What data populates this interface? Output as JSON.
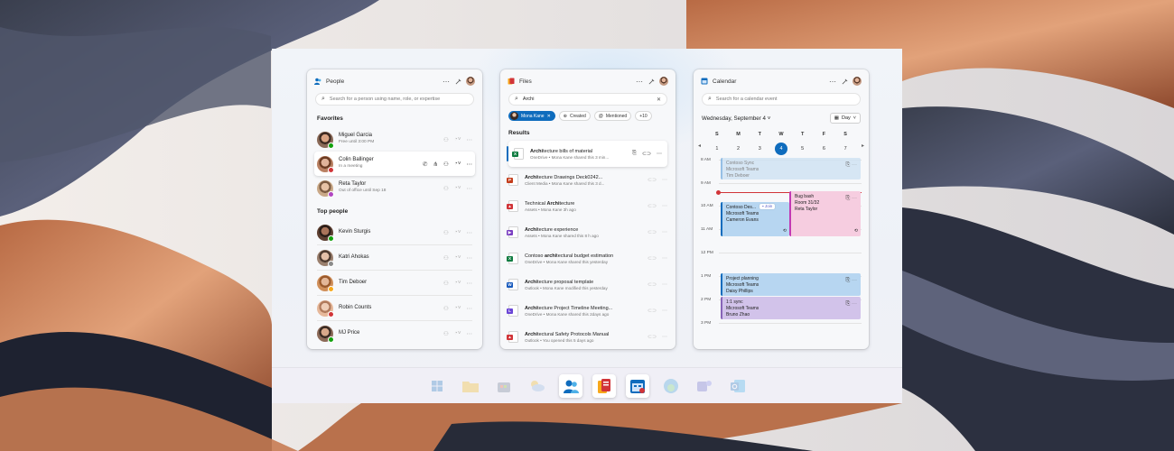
{
  "colors": {
    "accent": "#0f6cbd",
    "available": "#13a10e",
    "busy": "#d13438",
    "away": "#f7a81b",
    "offline": "#b146c2"
  },
  "people": {
    "title": "People",
    "search_placeholder": "Search for a person using name, role, or expertise",
    "favorites_heading": "Favorites",
    "favorites": [
      {
        "name": "Miguel Garcia",
        "status": "Free until 3:00 PM",
        "presence": "available"
      },
      {
        "name": "Colin Ballinger",
        "status": "In a meeting",
        "presence": "busy"
      },
      {
        "name": "Reta Taylor",
        "status": "Out of office until Sep 18",
        "presence": "offline"
      }
    ],
    "top_heading": "Top people",
    "top": [
      {
        "name": "Kevin Sturgis",
        "presence": "available"
      },
      {
        "name": "Katri Ahokas",
        "presence": "offline"
      },
      {
        "name": "Tim Deboer",
        "presence": "away"
      },
      {
        "name": "Robin Counts",
        "presence": "busy"
      },
      {
        "name": "MJ Price",
        "presence": "available"
      }
    ]
  },
  "files": {
    "title": "Files",
    "search_value": "Archi",
    "chips": {
      "person": "Mona Kane",
      "created": "Created",
      "mentioned": "Mentioned",
      "more": "+10"
    },
    "results_heading": "Results",
    "items": [
      {
        "name_bold": "Archi",
        "name_rest": "tecture bills of material",
        "meta": "OneDrive • Mona Kane shared this 3 min...",
        "type": "xlsx"
      },
      {
        "name_bold": "Archi",
        "name_rest": "tecture Drawings Deck0242...",
        "meta": "Client Media • Mona Kane shared this 3 d...",
        "type": "pptx"
      },
      {
        "name_pre": "Technical ",
        "name_bold": "Archi",
        "name_rest": "tecture",
        "meta": "Assets • Mona Kane 3h ago",
        "type": "pdf"
      },
      {
        "name_bold": "Archi",
        "name_rest": "tecture experience",
        "meta": "Assets • Mona Kane shared this 8 h ago",
        "type": "video"
      },
      {
        "name_pre": "Contoso ",
        "name_bold": "archi",
        "name_rest": "tectural budget estimation",
        "meta": "OneDrive • Mona Kane shared this yesterday",
        "type": "xlsx"
      },
      {
        "name_bold": "Archi",
        "name_rest": "tecture proposal template",
        "meta": "Outlook • Mona Kane modified this yesterday",
        "type": "docx"
      },
      {
        "name_bold": "Archi",
        "name_rest": "tecture Project Timeline Meeting...",
        "meta": "OneDrive • Mona Kane shared this 2days ago",
        "type": "loop"
      },
      {
        "name_bold": "Archi",
        "name_rest": "tectural Safety Protocols Manual",
        "meta": "Outlook • You opened this 5 days ago",
        "type": "pdf"
      }
    ]
  },
  "calendar": {
    "title": "Calendar",
    "search_placeholder": "Search for a calendar event",
    "date_label": "Wednesday, September 4",
    "view_label": "Day",
    "weekdays": [
      "S",
      "M",
      "T",
      "W",
      "T",
      "F",
      "S"
    ],
    "dates": [
      "1",
      "2",
      "3",
      "4",
      "5",
      "6",
      "7"
    ],
    "today": "4",
    "hours": [
      "8 AM",
      "9 AM",
      "10 AM",
      "11 AM",
      "12 PM",
      "1 PM",
      "2 PM",
      "3 PM"
    ],
    "events": [
      {
        "title": "Contoso Sync",
        "l2": "Microsoft Teams",
        "l3": "Tim Deboer"
      },
      {
        "title": "Contoso Des...",
        "l2": "Microsoft Teams",
        "l3": "Cameron Evans",
        "join": "Join"
      },
      {
        "title": "Bug bash",
        "l2": "Room 31/32",
        "l3": "Reta Taylor"
      },
      {
        "title": "Project planning",
        "l2": "Microsoft Teams",
        "l3": "Daisy Phillips"
      },
      {
        "title": "1:1 sync",
        "l2": "Microsoft Teams",
        "l3": "Bruno Zhao"
      }
    ]
  },
  "taskbar": {
    "icons": [
      "windows-start",
      "file-explorer",
      "store",
      "weather-widget",
      "people-app",
      "files-app",
      "calendar-app",
      "edge-browser",
      "teams",
      "outlook"
    ]
  }
}
